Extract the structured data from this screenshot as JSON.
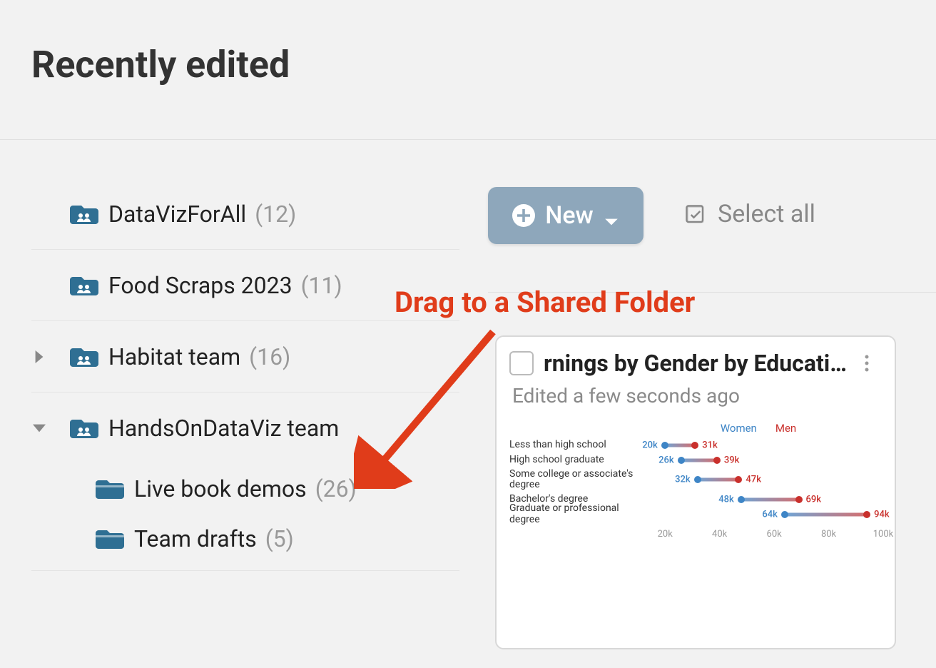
{
  "header": {
    "title": "Recently edited"
  },
  "sidebar": {
    "items": [
      {
        "label": "DataVizForAll",
        "count": "(12)",
        "type": "team",
        "caret": "none"
      },
      {
        "label": "Food Scraps 2023",
        "count": "(11)",
        "type": "team",
        "caret": "none"
      },
      {
        "label": "Habitat team",
        "count": "(16)",
        "type": "team",
        "caret": "right"
      },
      {
        "label": "HandsOnDataViz team",
        "count": "",
        "type": "team",
        "caret": "down"
      }
    ],
    "children": [
      {
        "label": "Live book demos",
        "count": "(26)"
      },
      {
        "label": "Team drafts",
        "count": "(5)"
      }
    ]
  },
  "toolbar": {
    "new_label": "New",
    "select_all_label": "Select all"
  },
  "annotation": {
    "text": "Drag to a Shared Folder"
  },
  "card": {
    "title": "rnings by Gender by Educati…",
    "subtitle": "Edited a few seconds ago"
  },
  "chart_data": {
    "type": "range-dot",
    "title": "Earnings by Gender by Education",
    "legend": {
      "women": "Women",
      "men": "Men"
    },
    "xlim": [
      10,
      100
    ],
    "xticks": [
      "20k",
      "40k",
      "60k",
      "80k",
      "100k"
    ],
    "categories": [
      {
        "label": "Less than high school",
        "women": 20,
        "women_label": "20k",
        "men": 31,
        "men_label": "31k"
      },
      {
        "label": "High school graduate",
        "women": 26,
        "women_label": "26k",
        "men": 39,
        "men_label": "39k"
      },
      {
        "label": "Some college or associate's degree",
        "women": 32,
        "women_label": "32k",
        "men": 47,
        "men_label": "47k"
      },
      {
        "label": "Bachelor's degree",
        "women": 48,
        "women_label": "48k",
        "men": 69,
        "men_label": "69k"
      },
      {
        "label": "Graduate or professional degree",
        "women": 64,
        "women_label": "64k",
        "men": 94,
        "men_label": "94k"
      }
    ]
  }
}
